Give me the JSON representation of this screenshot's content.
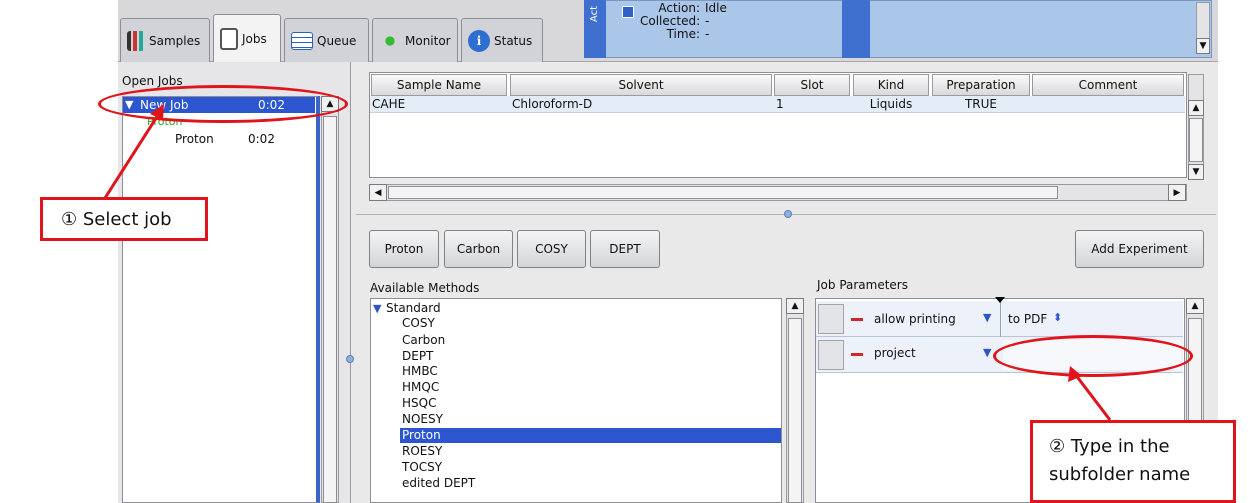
{
  "tabs": [
    {
      "label": "Samples",
      "icon": "samples-icon"
    },
    {
      "label": "Jobs",
      "icon": "jobs-icon"
    },
    {
      "label": "Queue",
      "icon": "queue-icon"
    },
    {
      "label": "Monitor",
      "icon": "monitor-icon"
    },
    {
      "label": "Status",
      "icon": "status-icon"
    }
  ],
  "status": {
    "strip_label": "Act",
    "action_label": "Action:",
    "action_value": "Idle",
    "collected_label": "Collected:",
    "collected_value": "-",
    "time_label": "Time:",
    "time_value": "-"
  },
  "open_jobs": {
    "title": "Open Jobs",
    "job_name": "New Job",
    "job_time": "0:02",
    "group_label": "Proton",
    "item_name": "Proton",
    "item_time": "0:02"
  },
  "sample_table": {
    "headers": [
      "Sample Name",
      "Solvent",
      "Slot",
      "Kind",
      "Preparation",
      "Comment"
    ],
    "rows": [
      {
        "sample": "CAHE",
        "solvent": "Chloroform-D",
        "slot": "1",
        "kind": "Liquids",
        "prep": "TRUE",
        "comment": ""
      }
    ]
  },
  "experiment_buttons": [
    "Proton",
    "Carbon",
    "COSY",
    "DEPT"
  ],
  "add_experiment": "Add Experiment",
  "available_methods": {
    "title": "Available Methods",
    "group": "Standard",
    "items": [
      "COSY",
      "Carbon",
      "DEPT",
      "HMBC",
      "HMQC",
      "HSQC",
      "NOESY",
      "Proton",
      "ROESY",
      "TOCSY",
      "edited DEPT"
    ],
    "selected": "Proton"
  },
  "job_parameters": {
    "title": "Job Parameters",
    "rows": [
      {
        "name": "allow printing",
        "value": "to PDF"
      },
      {
        "name": "project",
        "value": ""
      }
    ]
  },
  "annotations": {
    "select_job": "① Select job",
    "type_line1": "② Type in the",
    "type_line2": "subfolder name"
  },
  "colors": {
    "accent": "#3a64c8",
    "selection": "#3a64c8",
    "annotation": "#e0141a",
    "status_bg": "#aac7ea"
  }
}
